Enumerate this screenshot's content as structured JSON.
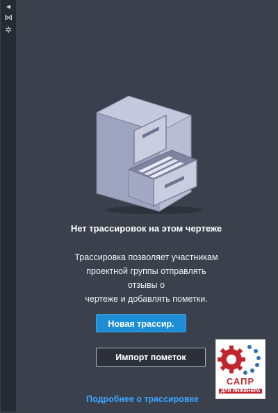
{
  "left_toolbar": {
    "icons": [
      "pin-icon",
      "collapse-icon",
      "settings-icon"
    ]
  },
  "empty_state": {
    "title": "Нет трассировок на этом чертеже",
    "description_lines": [
      "Трассировка позволяет участникам",
      "проектной группы отправлять отзывы о",
      "чертеже и добавлять пометки."
    ]
  },
  "actions": {
    "new_trace_label": "Новая трассир.",
    "import_markup_label": "Импорт пометок"
  },
  "learn_more_link": "Подробнее о трассировке",
  "watermark": {
    "line1": "САПР",
    "line2": "ДЛЯ ИНЖЕНЕРА"
  },
  "colors": {
    "panel_bg": "#3b414c",
    "primary_button": "#1d8ed6",
    "link": "#3ba2ff"
  }
}
